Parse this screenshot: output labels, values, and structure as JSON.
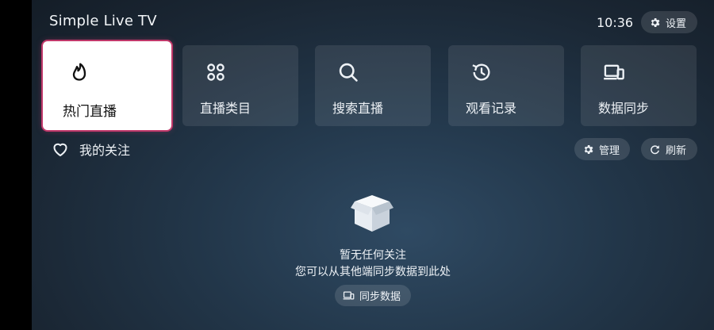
{
  "app": {
    "title": "Simple Live TV"
  },
  "header": {
    "time": "10:36",
    "settings_label": "设置"
  },
  "nav_cards": [
    {
      "label": "热门直播",
      "icon": "flame-icon",
      "active": true
    },
    {
      "label": "直播类目",
      "icon": "grid-icon",
      "active": false
    },
    {
      "label": "搜索直播",
      "icon": "search-icon",
      "active": false
    },
    {
      "label": "观看记录",
      "icon": "history-icon",
      "active": false
    },
    {
      "label": "数据同步",
      "icon": "devices-icon",
      "active": false
    }
  ],
  "follow_section": {
    "title": "我的关注",
    "icon": "heart-icon",
    "manage_label": "管理",
    "refresh_label": "刷新"
  },
  "empty_state": {
    "icon": "box-icon",
    "title": "暂无任何关注",
    "subtitle": "您可以从其他端同步数据到此处",
    "sync_button_label": "同步数据"
  },
  "colors": {
    "active_border": "#c0386a",
    "card_bg": "rgba(255,255,255,0.09)",
    "active_card_bg": "#ffffff"
  }
}
